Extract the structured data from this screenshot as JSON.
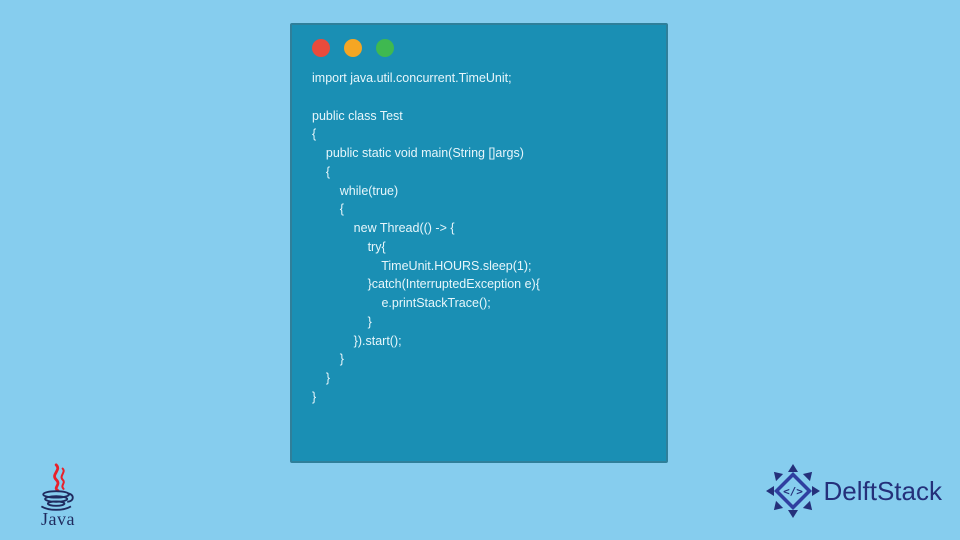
{
  "window": {
    "dots": [
      "red",
      "yellow",
      "green"
    ]
  },
  "code_lines": [
    "import java.util.concurrent.TimeUnit;",
    "",
    "public class Test",
    "{",
    "    public static void main(String []args)",
    "    {",
    "        while(true)",
    "        {",
    "            new Thread(() -> {",
    "                try{",
    "                    TimeUnit.HOURS.sleep(1);",
    "                }catch(InterruptedException e){",
    "                    e.printStackTrace();",
    "                }",
    "            }).start();",
    "        }",
    "    }",
    "}"
  ],
  "java_logo": {
    "label": "Java"
  },
  "brand": {
    "name": "DelftStack"
  },
  "colors": {
    "page_bg": "#86cdee",
    "window_bg": "#1a8fb4",
    "code_text": "#e7f6fb",
    "dot_red": "#e94b3c",
    "dot_yellow": "#f5a623",
    "dot_green": "#3fb950",
    "brand_navy": "#24307a",
    "java_navy": "#1f2b5f",
    "java_red": "#e8202a"
  }
}
